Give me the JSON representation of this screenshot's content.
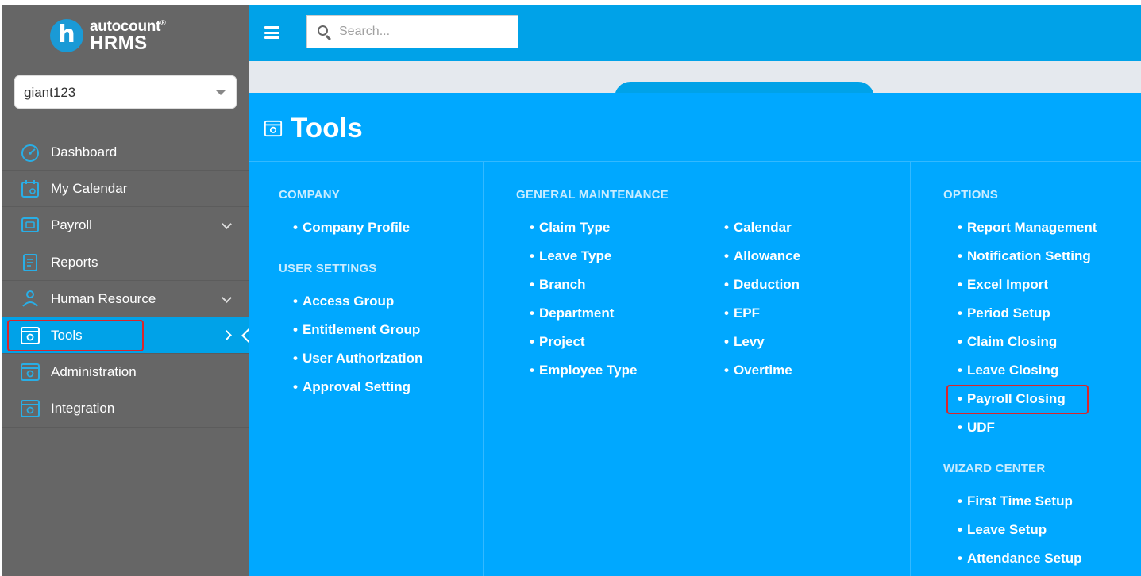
{
  "brand": {
    "line1": "autocount",
    "mark": "®",
    "line2": "HRMS",
    "letter": "h"
  },
  "company_select": {
    "value": "giant123"
  },
  "search": {
    "placeholder": "Search..."
  },
  "nav": [
    {
      "label": "Dashboard",
      "icon": "gauge-icon",
      "has_chevron": false
    },
    {
      "label": "My Calendar",
      "icon": "calendar-icon",
      "has_chevron": false
    },
    {
      "label": "Payroll",
      "icon": "payroll-icon",
      "has_chevron": true
    },
    {
      "label": "Reports",
      "icon": "report-icon",
      "has_chevron": false
    },
    {
      "label": "Human Resource",
      "icon": "human-resource-icon",
      "has_chevron": true
    },
    {
      "label": "Tools",
      "icon": "tools-window-icon",
      "has_chevron": true,
      "active": true
    },
    {
      "label": "Administration",
      "icon": "admin-window-icon",
      "has_chevron": false
    },
    {
      "label": "Integration",
      "icon": "integration-window-icon",
      "has_chevron": false
    }
  ],
  "panel": {
    "title": "Tools",
    "company": {
      "heading": "COMPANY",
      "items": [
        "Company Profile"
      ]
    },
    "user_settings": {
      "heading": "USER SETTINGS",
      "items": [
        "Access Group",
        "Entitlement Group",
        "User Authorization",
        "Approval Setting"
      ]
    },
    "general": {
      "heading": "GENERAL MAINTENANCE",
      "col1": [
        "Claim Type",
        "Leave Type",
        "Branch",
        "Department",
        "Project",
        "Employee Type"
      ],
      "col2": [
        "Calendar",
        "Allowance",
        "Deduction",
        "EPF",
        "Levy",
        "Overtime"
      ]
    },
    "options": {
      "heading": "OPTIONS",
      "items": [
        "Report Management",
        "Notification Setting",
        "Excel Import",
        "Period Setup",
        "Claim Closing",
        "Leave Closing",
        "Payroll Closing",
        "UDF"
      ]
    },
    "wizard": {
      "heading": "WIZARD CENTER",
      "items": [
        "First Time Setup",
        "Leave Setup",
        "Attendance Setup"
      ]
    }
  },
  "colors": {
    "accent": "#00a2e8",
    "panel": "#00a8ff",
    "sidebar": "#666666",
    "highlight": "#d9262c"
  }
}
